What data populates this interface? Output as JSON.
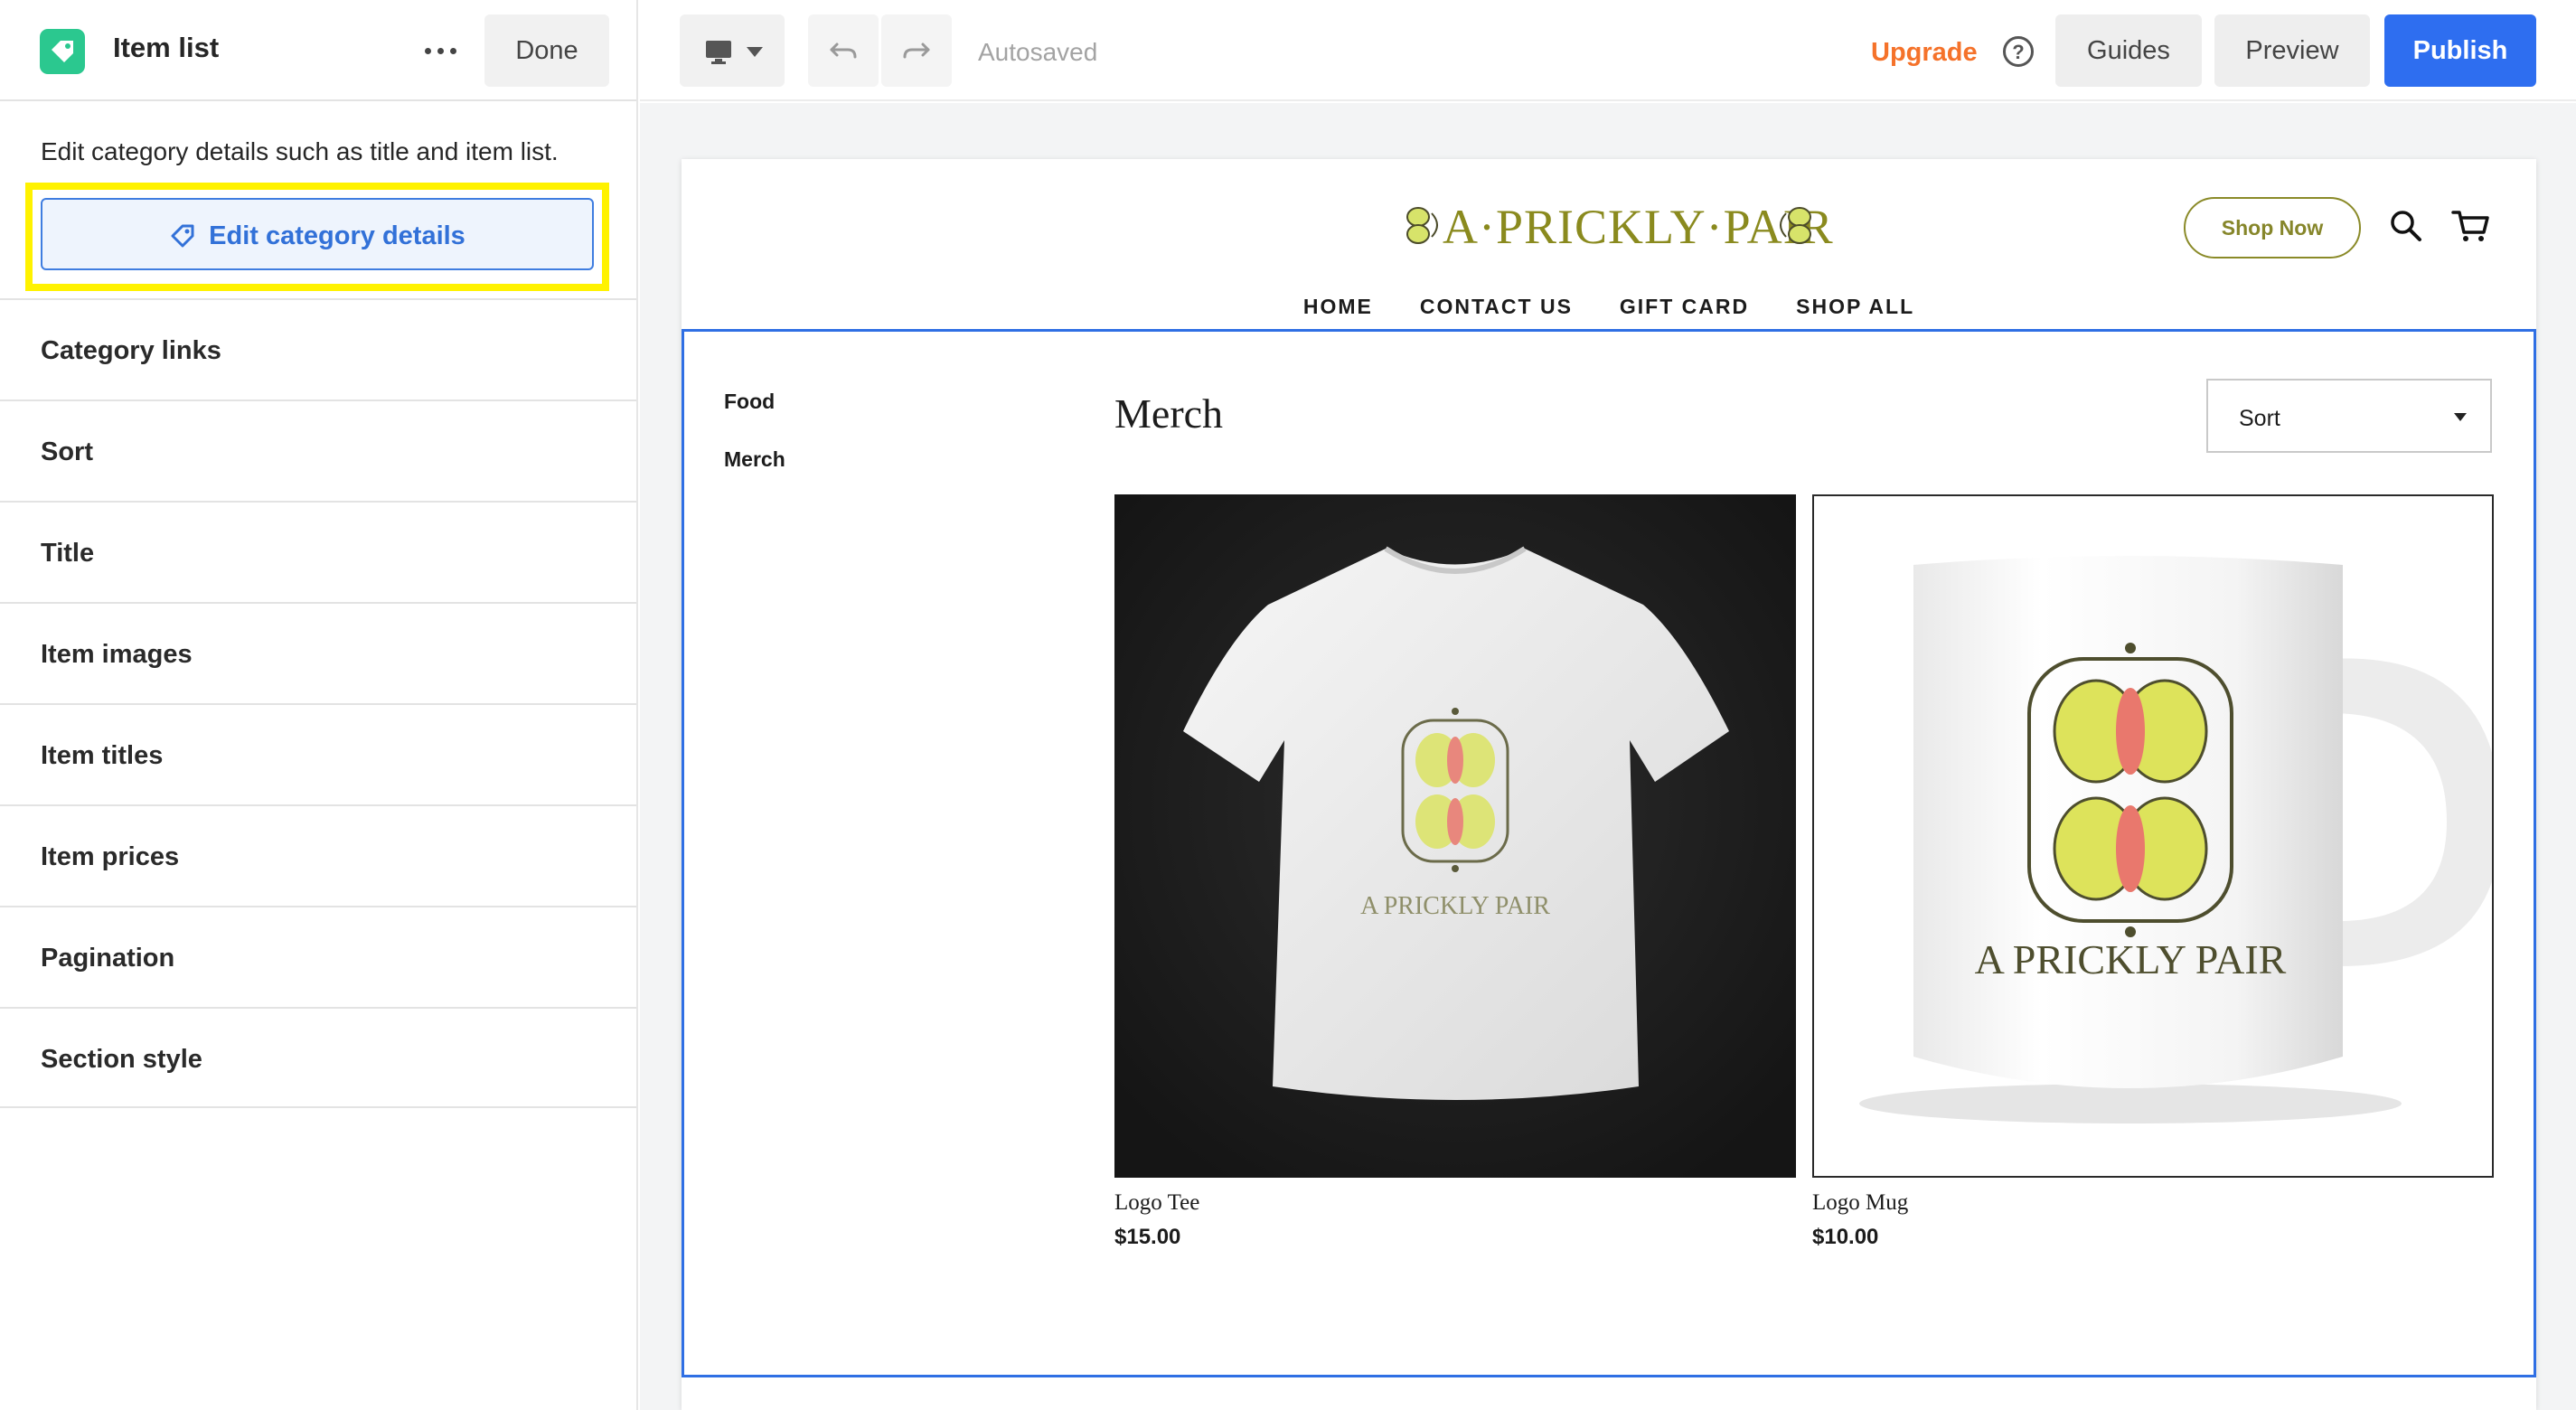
{
  "panel": {
    "title": "Item list",
    "done_label": "Done",
    "description": "Edit category details such as title and item list.",
    "edit_button_label": "Edit category details",
    "items": [
      {
        "label": "Category links"
      },
      {
        "label": "Sort"
      },
      {
        "label": "Title"
      },
      {
        "label": "Item images"
      },
      {
        "label": "Item titles"
      },
      {
        "label": "Item prices"
      },
      {
        "label": "Pagination"
      },
      {
        "label": "Section style"
      }
    ]
  },
  "toolbar": {
    "status": "Autosaved",
    "upgrade_label": "Upgrade",
    "help_glyph": "?",
    "guides_label": "Guides",
    "preview_label": "Preview",
    "publish_label": "Publish"
  },
  "site": {
    "brand": "A·PRICKLY·PAIR",
    "shop_now_label": "Shop Now",
    "nav": [
      "HOME",
      "CONTACT US",
      "GIFT CARD",
      "SHOP ALL"
    ],
    "categories": [
      "Food",
      "Merch"
    ],
    "category_title": "Merch",
    "sort_label": "Sort",
    "products": [
      {
        "title": "Logo Tee",
        "price": "$15.00",
        "print": "A PRICKLY PAIR"
      },
      {
        "title": "Logo Mug",
        "price": "$10.00",
        "print": "A PRICKLY PAIR"
      }
    ]
  },
  "colors": {
    "accent_blue": "#2e6ef0",
    "highlight_yellow": "#fff200",
    "upgrade_orange": "#f5722a",
    "brand_olive": "#8a8a1e",
    "logo_green": "#2bc88f"
  }
}
